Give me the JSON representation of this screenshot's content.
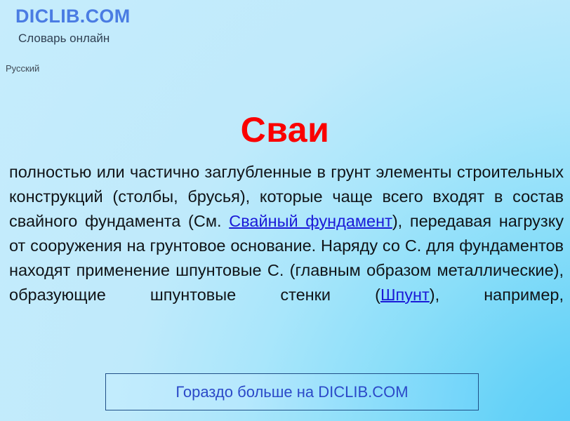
{
  "site": {
    "brand": "DICLIB.COM",
    "tagline": "Словарь онлайн",
    "language": "Русский"
  },
  "entry": {
    "title": "Сваи",
    "definition_parts": {
      "p1": "полностью или частично заглубленные в грунт элементы строительных конструкций (столбы, брусья), которые чаще всего входят в состав свайного фундамента  (См. ",
      "link1": "Свайный фундамент",
      "p2": "), передавая нагрузку от сооружения на грунтовое основание. Наряду со С. для фундаментов находят применение шпунтовые С. (главным образом металлические), образующие шпунтовые стенки (",
      "link2": "Шпунт",
      "p3": "), например,"
    },
    "definition_full": "полностью или частично заглубленные в грунт элементы строительных конструкций (столбы, брусья), которые чаще всего входят в состав свайного фундамента  (См. Свайный фундамент), передавая нагрузку от сооружения на грунтовое основание. Наряду со С. для фундаментов находят применение шпунтовые С. (главным образом металлические), образующие шпунтовые стенки (Шпунт), например,"
  },
  "cta": {
    "label": "Гораздо больше на DICLIB.COM"
  },
  "colors": {
    "brand": "#4a7ce3",
    "title": "#fa0000",
    "link": "#1a1ad8",
    "cta_text": "#2b49c8",
    "cta_border": "#1f4f87",
    "background_light": "#c6ecfc",
    "background_accent": "#4fc8f7",
    "body_text": "#101418",
    "tagline_text": "#2f4053"
  }
}
